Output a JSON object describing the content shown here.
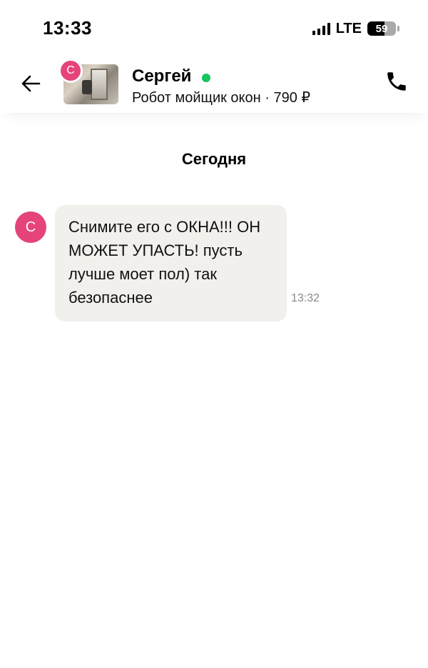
{
  "status_bar": {
    "time": "13:33",
    "network": "LTE",
    "battery": "59"
  },
  "header": {
    "contact_name": "Сергей",
    "avatar_letter": "С",
    "listing_subtitle": "Робот мойщик окон · 790 ₽",
    "online_color": "#17c45d",
    "icons": [
      "arrow-left-icon",
      "phone-icon"
    ]
  },
  "chat": {
    "date_label": "Сегодня",
    "messages": [
      {
        "avatar_letter": "С",
        "text": "Снимите его с ОКНА!!! ОН МОЖЕТ УПАСТЬ! пусть лучше моет пол) так безопаснее",
        "time": "13:32"
      }
    ]
  },
  "colors": {
    "avatar": "#e4447a",
    "bubble": "#f2f0ec",
    "timestamp": "#8a8a8a"
  }
}
